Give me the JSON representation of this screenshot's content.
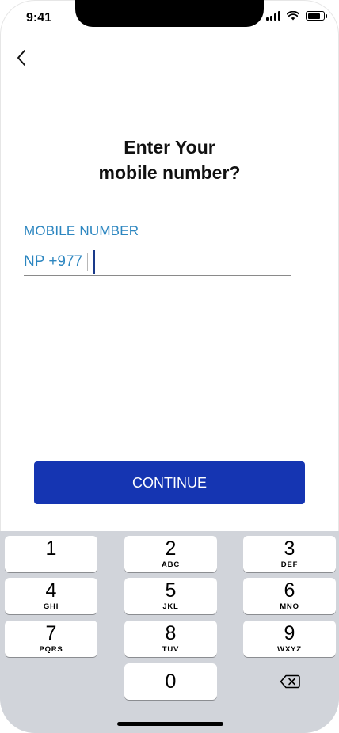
{
  "status_bar": {
    "time": "9:41",
    "battery_level": 0.85
  },
  "header": {
    "back_icon": "chevron-left-icon"
  },
  "main": {
    "title_line1": "Enter Your",
    "title_line2": "mobile number?",
    "field_label": "MOBILE NUMBER",
    "country_code": "NP +977",
    "phone_value": "",
    "phone_placeholder": ""
  },
  "actions": {
    "continue_label": "CONTINUE"
  },
  "keypad": {
    "keys": [
      {
        "num": "1",
        "letters": ""
      },
      {
        "num": "2",
        "letters": "ABC"
      },
      {
        "num": "3",
        "letters": "DEF"
      },
      {
        "num": "4",
        "letters": "GHI"
      },
      {
        "num": "5",
        "letters": "JKL"
      },
      {
        "num": "6",
        "letters": "MNO"
      },
      {
        "num": "7",
        "letters": "PQRS"
      },
      {
        "num": "8",
        "letters": "TUV"
      },
      {
        "num": "9",
        "letters": "WXYZ"
      },
      {
        "num": "0",
        "letters": ""
      }
    ],
    "delete_icon": "backspace-icon"
  },
  "colors": {
    "accent": "#1535B2",
    "label_blue": "#2C86C0",
    "keyboard_bg": "#D1D4DA"
  }
}
